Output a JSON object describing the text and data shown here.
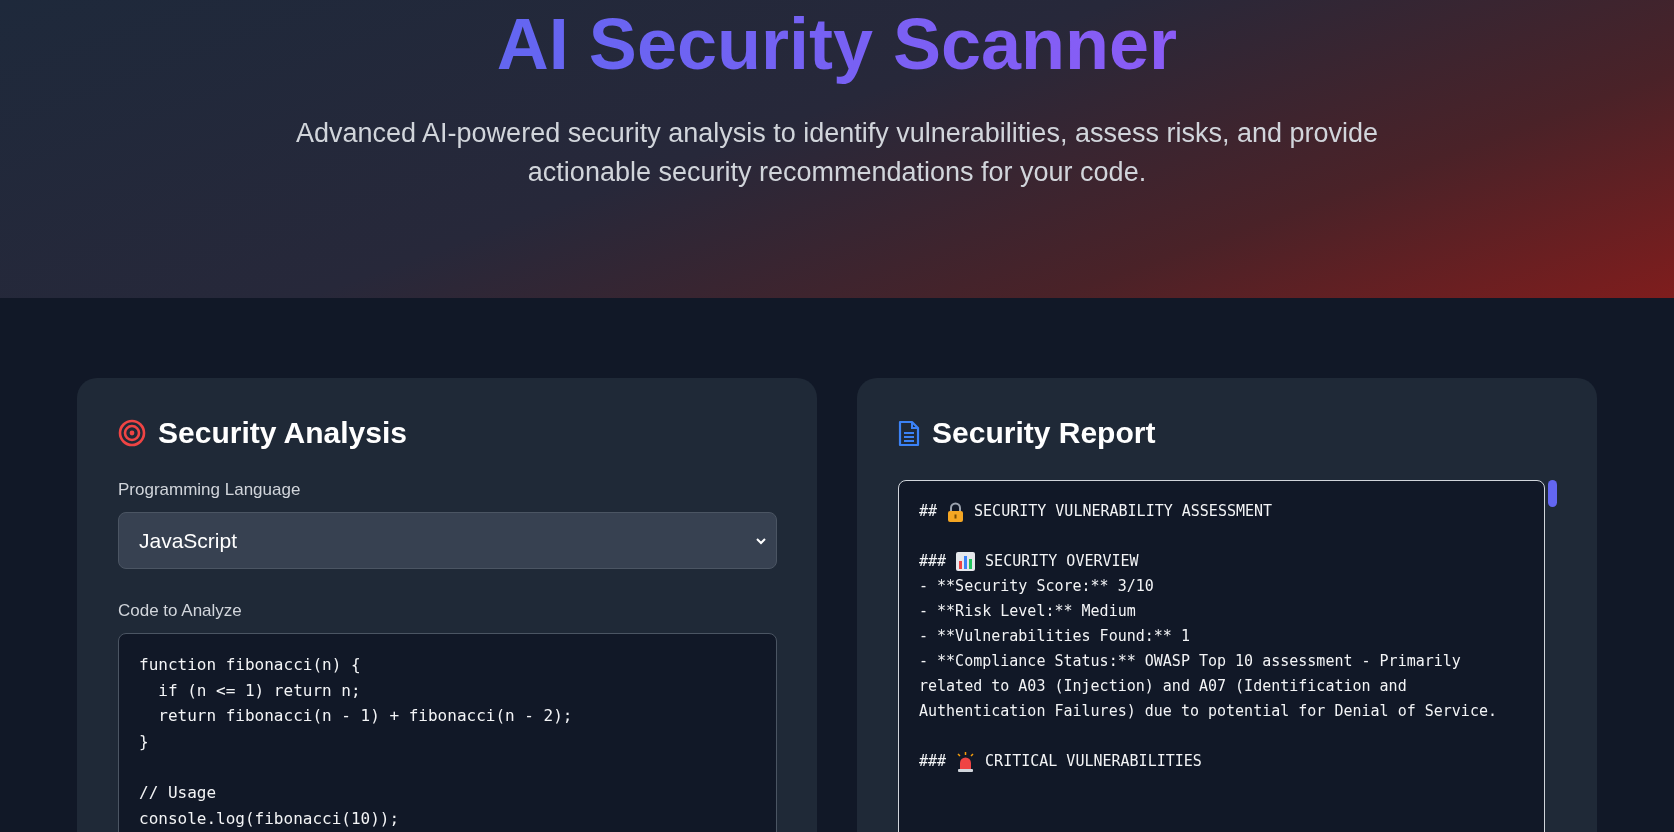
{
  "header": {
    "title": "AI Security Scanner",
    "subtitle": "Advanced AI-powered security analysis to identify vulnerabilities, assess risks, and provide actionable security recommendations for your code."
  },
  "analysis": {
    "title": "Security Analysis",
    "language_label": "Programming Language",
    "language": "JavaScript",
    "code_label": "Code to Analyze",
    "code_blocks": [
      {
        "lines": [
          "function fibonacci(n) {",
          "  if (n <= 1) return n;",
          "  return fibonacci(n - 1) + fibonacci(n - 2);",
          "}"
        ]
      },
      {
        "lines": [
          "// Usage",
          "console.log(fibonacci(10));"
        ]
      }
    ]
  },
  "report": {
    "title": "Security Report",
    "blocks": [
      {
        "lines": [
          {
            "kind": "heading",
            "marker": "##",
            "text": "SECURITY VULNERABILITY ASSESSMENT"
          }
        ]
      },
      {
        "lines": [
          {
            "kind": "heading",
            "marker": "###",
            "text": "SECURITY OVERVIEW"
          },
          {
            "kind": "text",
            "text": "- **Security Score:** 3/10"
          },
          {
            "kind": "text",
            "text": "- **Risk Level:** Medium"
          },
          {
            "kind": "text",
            "text": "- **Vulnerabilities Found:** 1"
          },
          {
            "kind": "text",
            "text": "- **Compliance Status:** OWASP Top 10 assessment - Primarily related to A03 (Injection) and A07 (Identification and Authentication Failures) due to potential for Denial of Service."
          }
        ]
      },
      {
        "lines": [
          {
            "kind": "heading",
            "marker": "###",
            "text": "CRITICAL VULNERABILITIES"
          }
        ]
      }
    ]
  }
}
